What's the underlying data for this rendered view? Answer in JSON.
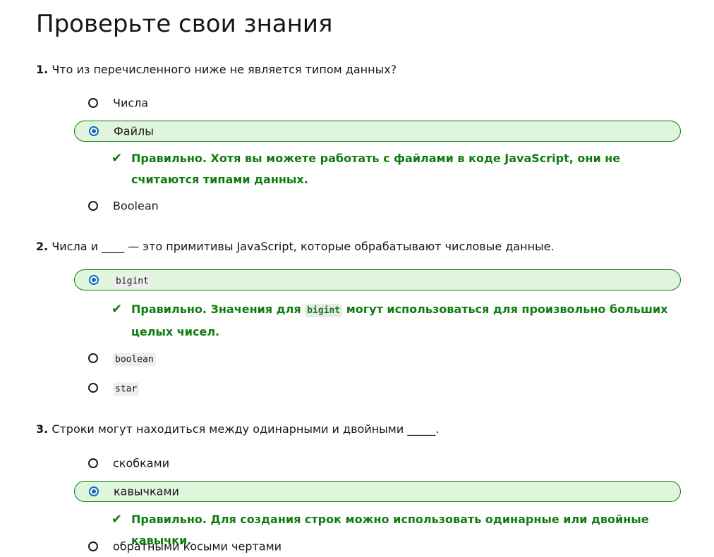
{
  "title": "Проверьте свои знания",
  "questions": [
    {
      "num": "1.",
      "text": "Что из перечисленного ниже не является типом данных?",
      "options": [
        "Числа",
        "Файлы",
        "Boolean"
      ],
      "selected": "Файлы",
      "feedback": "Правильно. Хотя вы можете работать с файлами в коде JavaScript, они не считаются типами данных."
    },
    {
      "num": "2.",
      "text": "Числа и ____ — это примитивы JavaScript, которые обрабатывают числовые данные.",
      "options": [
        "bigint",
        "boolean",
        "star"
      ],
      "selected": "bigint",
      "feedback_before": "Правильно. Значения для",
      "feedback_code": "bigint",
      "feedback_after": "могут использоваться для произвольно больших целых чисел."
    },
    {
      "num": "3.",
      "text": "Строки могут находиться между одинарными и двойными _____.",
      "options": [
        "скобками",
        "кавычками",
        "обратными косыми чертами"
      ],
      "selected": "кавычками",
      "feedback": "Правильно. Для создания строк можно использовать одинарные или двойные кавычки."
    }
  ],
  "colors": {
    "correct_text": "#107c10",
    "selected_bg": "#dff6dd",
    "radio_accent": "#0f6cbd"
  },
  "icons": {
    "feedback": "checkmark-icon"
  }
}
